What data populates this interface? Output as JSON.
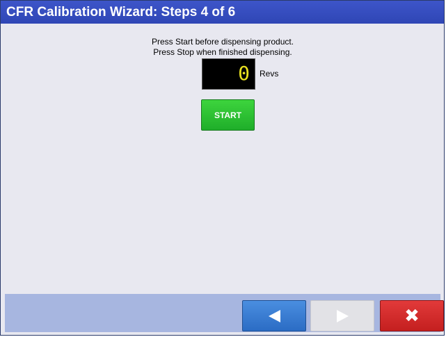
{
  "window": {
    "title": "CFR Calibration Wizard: Steps 4 of 6"
  },
  "instructions": {
    "line1": "Press Start before dispensing product.",
    "line2": "Press Stop when finished dispensing."
  },
  "counter": {
    "value": "0",
    "unit": "Revs"
  },
  "start_button": {
    "label": "START"
  },
  "footer": {
    "back_icon": "left-triangle",
    "next_icon": "right-triangle",
    "cancel_icon": "x-mark",
    "cancel_glyph": "✖"
  },
  "colors": {
    "title_bar": "#3d55c9",
    "start_green": "#2fc43a",
    "back_blue": "#3b7fd4",
    "cancel_red": "#d42a2a",
    "footer_bg": "#a7b6e0",
    "counter_digit": "#e8e020"
  }
}
